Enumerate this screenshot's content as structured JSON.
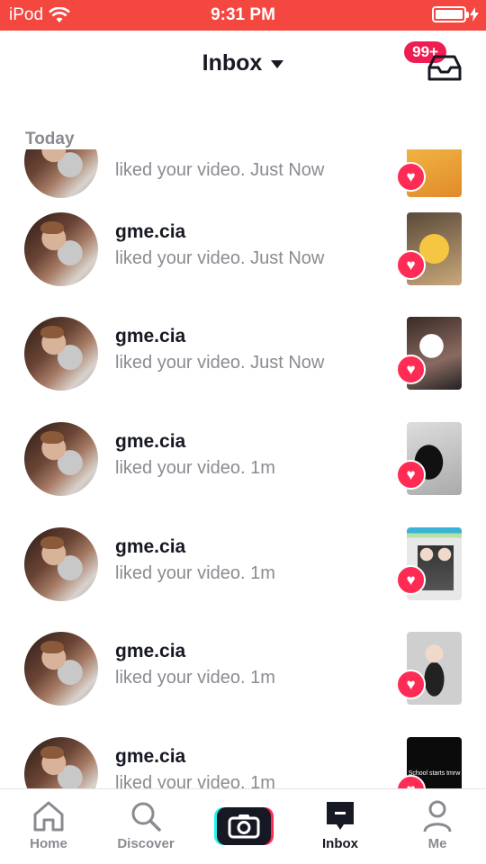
{
  "status_bar": {
    "carrier": "iPod",
    "time": "9:31 PM"
  },
  "header": {
    "title": "Inbox",
    "badge": "99+"
  },
  "section_label": "Today",
  "notifications": [
    {
      "username": "",
      "message": "liked your video. Just Now"
    },
    {
      "username": "gme.cia",
      "message": "liked your video. Just Now"
    },
    {
      "username": "gme.cia",
      "message": "liked your video. Just Now"
    },
    {
      "username": "gme.cia",
      "message": "liked your video. 1m"
    },
    {
      "username": "gme.cia",
      "message": "liked your video. 1m"
    },
    {
      "username": "gme.cia",
      "message": "liked your video. 1m"
    },
    {
      "username": "gme.cia",
      "message": "liked your video. 1m"
    }
  ],
  "thumbnail_text": "School starts tmrw",
  "tabs": {
    "home": "Home",
    "discover": "Discover",
    "inbox": "Inbox",
    "me": "Me"
  },
  "colors": {
    "status_bar": "#f4473f",
    "accent": "#fe2c55",
    "cyan": "#25f4ee"
  }
}
